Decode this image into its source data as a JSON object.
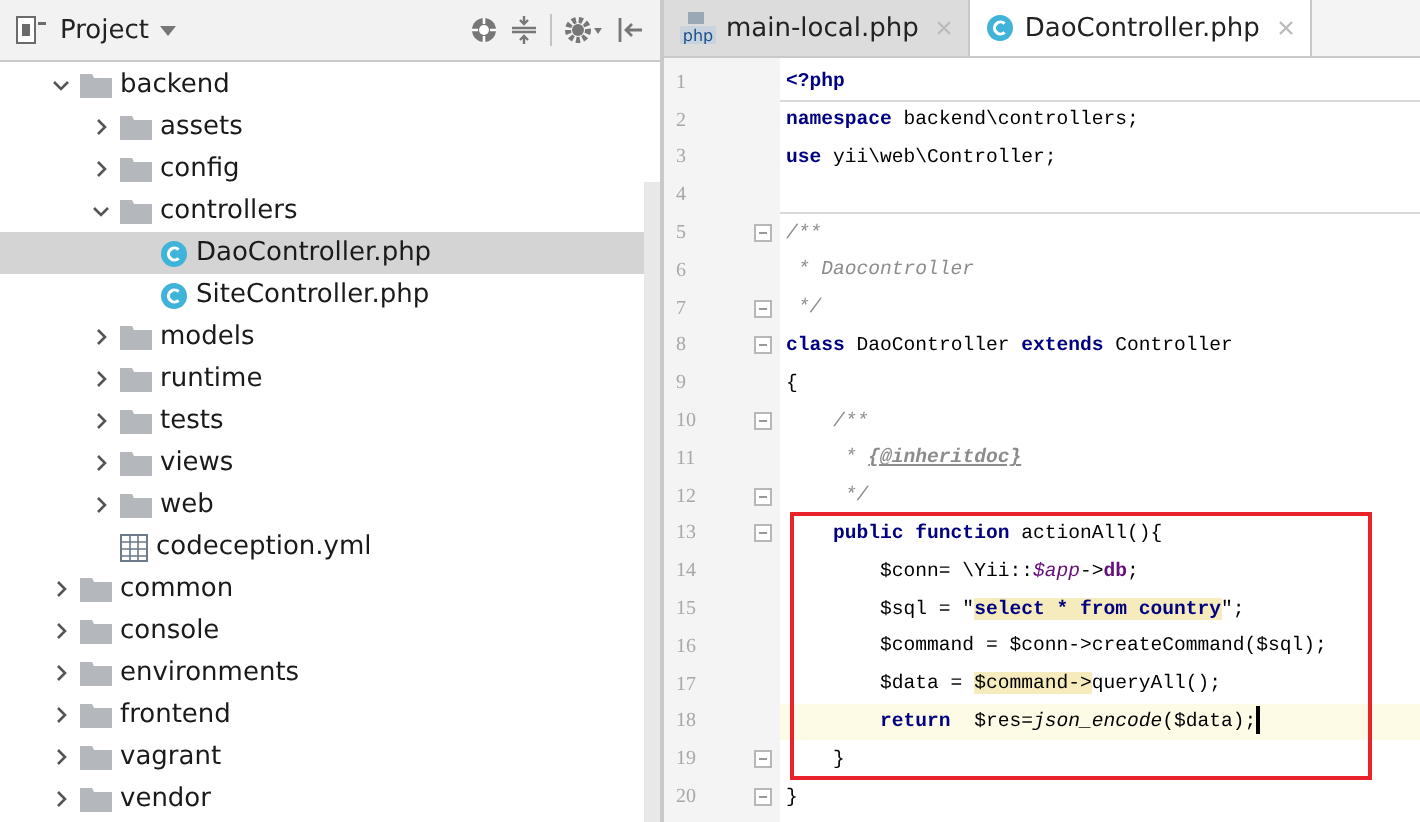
{
  "project_panel": {
    "title": "Project",
    "tree": [
      {
        "label": "backend",
        "kind": "folder",
        "expanded": true,
        "selected": false,
        "children": [
          {
            "label": "assets",
            "kind": "folder",
            "expanded": false,
            "selected": false
          },
          {
            "label": "config",
            "kind": "folder",
            "expanded": false,
            "selected": false
          },
          {
            "label": "controllers",
            "kind": "folder",
            "expanded": true,
            "selected": false,
            "children": [
              {
                "label": "DaoController.php",
                "kind": "class",
                "selected": true
              },
              {
                "label": "SiteController.php",
                "kind": "class",
                "selected": false
              }
            ]
          },
          {
            "label": "models",
            "kind": "folder",
            "expanded": false,
            "selected": false
          },
          {
            "label": "runtime",
            "kind": "folder",
            "expanded": false,
            "selected": false
          },
          {
            "label": "tests",
            "kind": "folder",
            "expanded": false,
            "selected": false
          },
          {
            "label": "views",
            "kind": "folder",
            "expanded": false,
            "selected": false
          },
          {
            "label": "web",
            "kind": "folder",
            "expanded": false,
            "selected": false
          },
          {
            "label": "codeception.yml",
            "kind": "yml",
            "selected": false
          }
        ]
      },
      {
        "label": "common",
        "kind": "folder",
        "expanded": false,
        "selected": false
      },
      {
        "label": "console",
        "kind": "folder",
        "expanded": false,
        "selected": false
      },
      {
        "label": "environments",
        "kind": "folder",
        "expanded": false,
        "selected": false
      },
      {
        "label": "frontend",
        "kind": "folder",
        "expanded": false,
        "selected": false
      },
      {
        "label": "vagrant",
        "kind": "folder",
        "expanded": false,
        "selected": false
      },
      {
        "label": "vendor",
        "kind": "folder",
        "expanded": false,
        "selected": false
      }
    ]
  },
  "editor": {
    "tabs": [
      {
        "label": "main-local.php",
        "kind": "php",
        "icon_text": "php",
        "selected": false
      },
      {
        "label": "DaoController.php",
        "kind": "class",
        "selected": true
      }
    ],
    "blocks": [
      {
        "boxed": false,
        "lines": [
          {
            "number": "1",
            "fold": false,
            "separator": true,
            "tokens": [
              {
                "text": "<?php",
                "kind": "keyword"
              }
            ]
          },
          {
            "number": "2",
            "fold": false,
            "separator": false,
            "tokens": [
              {
                "text": "namespace",
                "kind": "keyword"
              },
              {
                "text": " backend\\controllers;",
                "kind": "plain"
              }
            ]
          },
          {
            "number": "3",
            "fold": false,
            "separator": false,
            "tokens": [
              {
                "text": "use",
                "kind": "keyword"
              },
              {
                "text": " yii\\web\\Controller;",
                "kind": "plain"
              }
            ]
          },
          {
            "number": "4",
            "fold": false,
            "separator": true
          },
          {
            "number": "5",
            "fold": true,
            "separator": false,
            "tokens": [
              {
                "text": "/**",
                "kind": "comment"
              }
            ]
          },
          {
            "number": "6",
            "fold": false,
            "separator": false,
            "tokens": [
              {
                "text": " * Daocontroller",
                "kind": "comment"
              }
            ]
          },
          {
            "number": "7",
            "fold": true,
            "separator": false,
            "tokens": [
              {
                "text": " */",
                "kind": "comment"
              }
            ]
          },
          {
            "number": "8",
            "fold": true,
            "separator": false,
            "tokens": [
              {
                "text": "class",
                "kind": "keyword"
              },
              {
                "text": " DaoController ",
                "kind": "plain"
              },
              {
                "text": "extends",
                "kind": "keyword"
              },
              {
                "text": " Controller",
                "kind": "plain"
              }
            ]
          },
          {
            "number": "9",
            "fold": false,
            "separator": false,
            "tokens": [
              {
                "text": "{",
                "kind": "plain"
              }
            ]
          },
          {
            "number": "10",
            "fold": true,
            "separator": false,
            "tokens": [
              {
                "text": "    /**",
                "kind": "comment"
              }
            ]
          },
          {
            "number": "11",
            "fold": false,
            "separator": false,
            "tokens": [
              {
                "text": "     * ",
                "kind": "comment"
              },
              {
                "text": "{@inheritdoc}",
                "kind": "doctag"
              }
            ]
          },
          {
            "number": "12",
            "fold": true,
            "separator": false,
            "tokens": [
              {
                "text": "     */",
                "kind": "comment"
              }
            ]
          }
        ]
      },
      {
        "boxed": true,
        "lines": [
          {
            "number": "13",
            "fold": true,
            "separator": false,
            "tokens": [
              {
                "text": "    public function",
                "kind": "keyword"
              },
              {
                "text": " actionAll(){",
                "kind": "plain"
              }
            ]
          },
          {
            "number": "14",
            "fold": false,
            "separator": false,
            "tokens": [
              {
                "text": "        $conn= \\Yii::",
                "kind": "plain"
              },
              {
                "text": "$app",
                "kind": "static"
              },
              {
                "text": "->",
                "kind": "plain"
              },
              {
                "text": "db",
                "kind": "field"
              },
              {
                "text": ";",
                "kind": "plain"
              }
            ]
          },
          {
            "number": "15",
            "fold": false,
            "separator": false,
            "tokens": [
              {
                "text": "        $sql = \"",
                "kind": "plain",
                "marked": false
              },
              {
                "text": "select * from country",
                "kind": "sql",
                "marked": true
              },
              {
                "text": "\";",
                "kind": "plain",
                "marked": false
              }
            ]
          },
          {
            "number": "16",
            "fold": false,
            "separator": false,
            "tokens": [
              {
                "text": "        $command = $conn->createCommand($sql);",
                "kind": "plain"
              }
            ]
          },
          {
            "number": "17",
            "fold": false,
            "separator": false,
            "tokens": [
              {
                "text": "        $data = ",
                "kind": "plain",
                "marked": false
              },
              {
                "text": "$command->",
                "kind": "plain",
                "marked": true
              },
              {
                "text": "queryAll();",
                "kind": "plain",
                "marked": false
              }
            ]
          },
          {
            "number": "18",
            "fold": false,
            "separator": false,
            "current": true,
            "tokens": [
              {
                "text": "        return",
                "kind": "keyword"
              },
              {
                "text": "  $res=",
                "kind": "plain"
              },
              {
                "text": "json_encode",
                "kind": "function"
              },
              {
                "text": "($data);",
                "kind": "plain"
              }
            ]
          },
          {
            "number": "19",
            "fold": true,
            "separator": false,
            "tokens": [
              {
                "text": "    }",
                "kind": "plain"
              }
            ]
          }
        ]
      },
      {
        "boxed": false,
        "lines": [
          {
            "number": "20",
            "fold": true,
            "separator": false,
            "tokens": [
              {
                "text": "}",
                "kind": "plain"
              }
            ]
          }
        ]
      }
    ]
  }
}
